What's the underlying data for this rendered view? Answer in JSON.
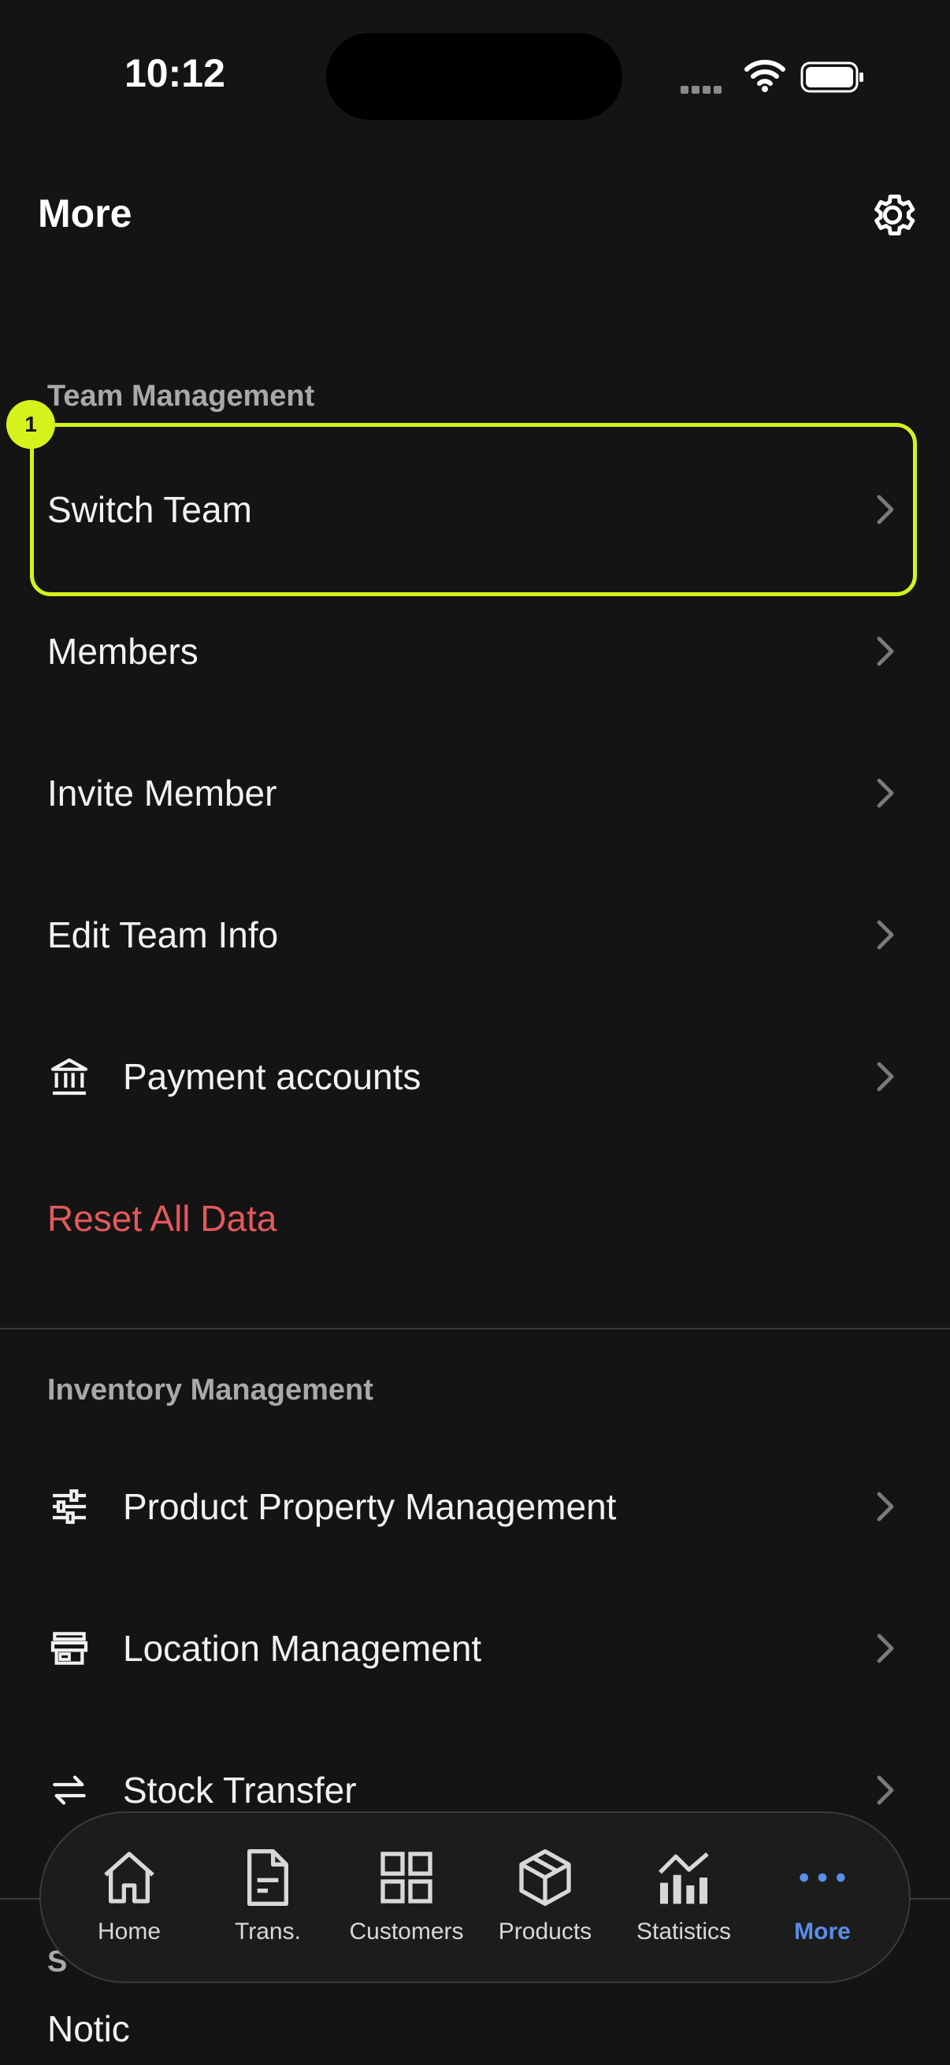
{
  "status_bar": {
    "time": "10:12"
  },
  "header": {
    "title": "More"
  },
  "sections": {
    "team": {
      "title": "Team Management",
      "items": [
        {
          "label": "Switch Team"
        },
        {
          "label": "Members"
        },
        {
          "label": "Invite Member"
        },
        {
          "label": "Edit Team Info"
        },
        {
          "label": "Payment accounts",
          "icon": "bank-icon"
        },
        {
          "label": "Reset All Data"
        }
      ]
    },
    "inventory": {
      "title": "Inventory Management",
      "items": [
        {
          "label": "Product Property Management",
          "icon": "sliders-icon"
        },
        {
          "label": "Location Management",
          "icon": "storefront-icon"
        },
        {
          "label": "Stock Transfer",
          "icon": "transfer-arrows-icon"
        }
      ]
    },
    "next": {
      "title_partial": "S",
      "first_item_partial": "Notic"
    }
  },
  "highlight": {
    "badge": "1"
  },
  "tab_bar": {
    "tabs": [
      {
        "label": "Home",
        "icon": "home-icon"
      },
      {
        "label": "Trans.",
        "icon": "document-icon"
      },
      {
        "label": "Customers",
        "icon": "grid-icon"
      },
      {
        "label": "Products",
        "icon": "box-icon"
      },
      {
        "label": "Statistics",
        "icon": "chart-icon"
      },
      {
        "label": "More",
        "icon": "more-dots-icon",
        "active": true
      }
    ]
  },
  "colors": {
    "accent": "#5b8dea",
    "danger": "#e4595c",
    "highlight": "#d6f21c",
    "background": "#141414"
  }
}
